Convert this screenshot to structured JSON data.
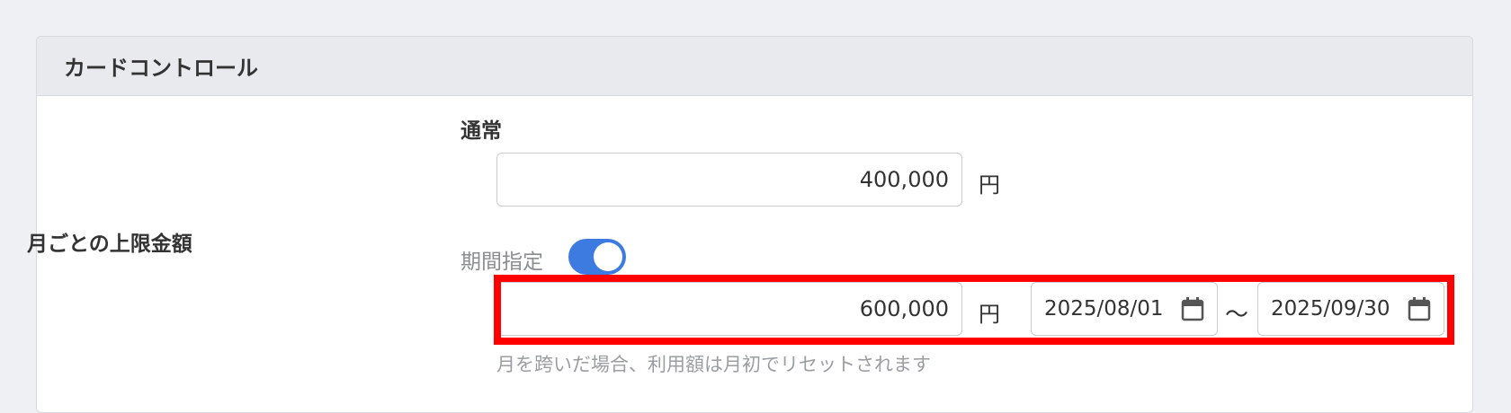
{
  "card": {
    "title": "カードコントロール"
  },
  "row": {
    "label": "月ごとの上限金額"
  },
  "normal": {
    "label": "通常",
    "amount": "400,000",
    "unit": "円"
  },
  "period": {
    "label": "期間指定",
    "toggle_on": true,
    "amount": "600,000",
    "unit": "円",
    "start_date": "2025/08/01",
    "end_date": "2025/09/30",
    "separator": "〜",
    "note": "月を跨いだ場合、利用額は月初でリセットされます"
  },
  "colors": {
    "accent": "#3d7be0",
    "highlight": "#ff0000"
  },
  "icons": {
    "date_icon": "calendar-icon"
  }
}
